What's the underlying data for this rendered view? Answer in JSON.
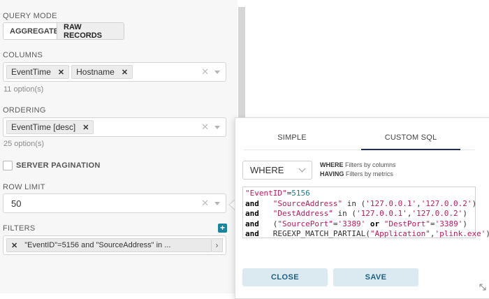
{
  "query_mode": {
    "label": "QUERY MODE",
    "options": [
      "AGGREGATE",
      "RAW RECORDS"
    ],
    "selected": "RAW RECORDS"
  },
  "columns": {
    "label": "COLUMNS",
    "tags": [
      "EventTime",
      "Hostname"
    ],
    "hint": "11 option(s)"
  },
  "ordering": {
    "label": "ORDERING",
    "tags": [
      "EventTime [desc]"
    ],
    "hint": "25 option(s)"
  },
  "server_pagination": {
    "label": "SERVER PAGINATION",
    "checked": false
  },
  "row_limit": {
    "label": "ROW LIMIT",
    "value": "50"
  },
  "filters": {
    "label": "FILTERS",
    "pill": "\"EventID\"=5156 and \"SourceAddress\" in ..."
  },
  "popover": {
    "tabs": [
      "SIMPLE",
      "CUSTOM SQL"
    ],
    "active_tab": "CUSTOM SQL",
    "clause_select": "WHERE",
    "explain": [
      {
        "kw": "WHERE",
        "text": " Filters by columns"
      },
      {
        "kw": "HAVING",
        "text": " Filters by metrics"
      }
    ],
    "sql_lines": [
      "\"EventID\"=5156",
      "and   \"SourceAddress\" in ('127.0.0.1','127.0.0.2')",
      "and   \"DestAddress\" in ('127.0.0.1','127.0.0.2')",
      "and   (\"SourcePort\"='3389' or \"DestPort\"='3389')",
      "and   REGEXP_MATCH_PARTIAL(\"Application\",'plink.exe')"
    ],
    "close_label": "CLOSE",
    "save_label": "SAVE"
  },
  "colors": {
    "accent": "#1a85a0",
    "tab_underline": "#1f2d5a",
    "button_bg": "#dbeaf1",
    "string": "#c2185b",
    "number": "#1f7a8c"
  }
}
